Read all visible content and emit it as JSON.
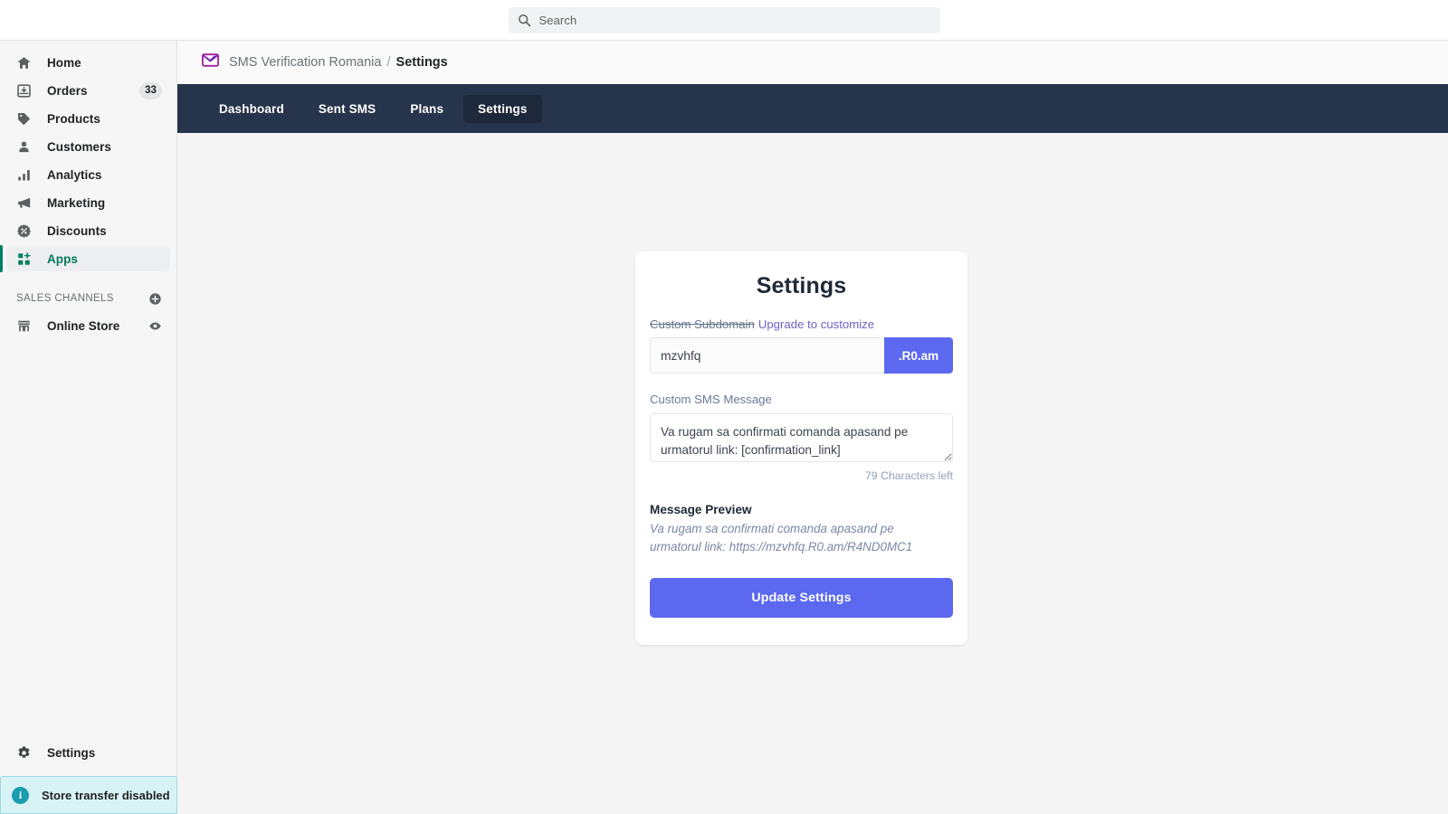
{
  "search": {
    "placeholder": "Search",
    "icon": "search-icon"
  },
  "sidebar": {
    "items": [
      {
        "label": "Home",
        "icon": "home-icon"
      },
      {
        "label": "Orders",
        "icon": "orders-inbox-icon",
        "badge": "33"
      },
      {
        "label": "Products",
        "icon": "tag-icon"
      },
      {
        "label": "Customers",
        "icon": "person-icon"
      },
      {
        "label": "Analytics",
        "icon": "bar-chart-icon"
      },
      {
        "label": "Marketing",
        "icon": "megaphone-icon"
      },
      {
        "label": "Discounts",
        "icon": "discount-badge-icon"
      },
      {
        "label": "Apps",
        "icon": "apps-grid-plus-icon",
        "active": true
      }
    ],
    "sales_channels": {
      "title": "SALES CHANNELS",
      "add_icon": "plus-circle-icon",
      "items": [
        {
          "label": "Online Store",
          "icon": "storefront-icon",
          "trailing_icon": "eye-icon"
        }
      ]
    },
    "settings": {
      "label": "Settings",
      "icon": "gear-icon"
    },
    "transfer_note": {
      "label": "Store transfer disabled",
      "icon": "info-circle-icon"
    }
  },
  "breadcrumb": {
    "app_icon": "envelope-check-icon",
    "app_name": "SMS Verification Romania",
    "separator": "/",
    "current": "Settings"
  },
  "app_nav": {
    "tabs": [
      {
        "label": "Dashboard",
        "active": false
      },
      {
        "label": "Sent SMS",
        "active": false
      },
      {
        "label": "Plans",
        "active": false
      },
      {
        "label": "Settings",
        "active": true
      }
    ]
  },
  "settings_card": {
    "title": "Settings",
    "subdomain": {
      "label": "Custom Subdomain",
      "upgrade_link": "Upgrade to customize",
      "value": "mzvhfq",
      "suffix": ".R0.am"
    },
    "sms_message": {
      "label": "Custom SMS Message",
      "value": "Va rugam sa confirmati comanda apasand pe urmatorul link: [confirmation_link]",
      "characters_left": "79 Characters left"
    },
    "preview": {
      "title": "Message Preview",
      "text": "Va rugam sa confirmati comanda apasand pe urmatorul link: https://mzvhfq.R0.am/R4ND0MC1"
    },
    "submit_label": "Update Settings"
  },
  "colors": {
    "accent_indigo": "#5b68ef",
    "nav_dark": "#26354b",
    "nav_active": "#1d293b",
    "sidebar_green": "#008060",
    "brand_purple": "#a020a0",
    "info_teal": "#1a9cb0"
  }
}
